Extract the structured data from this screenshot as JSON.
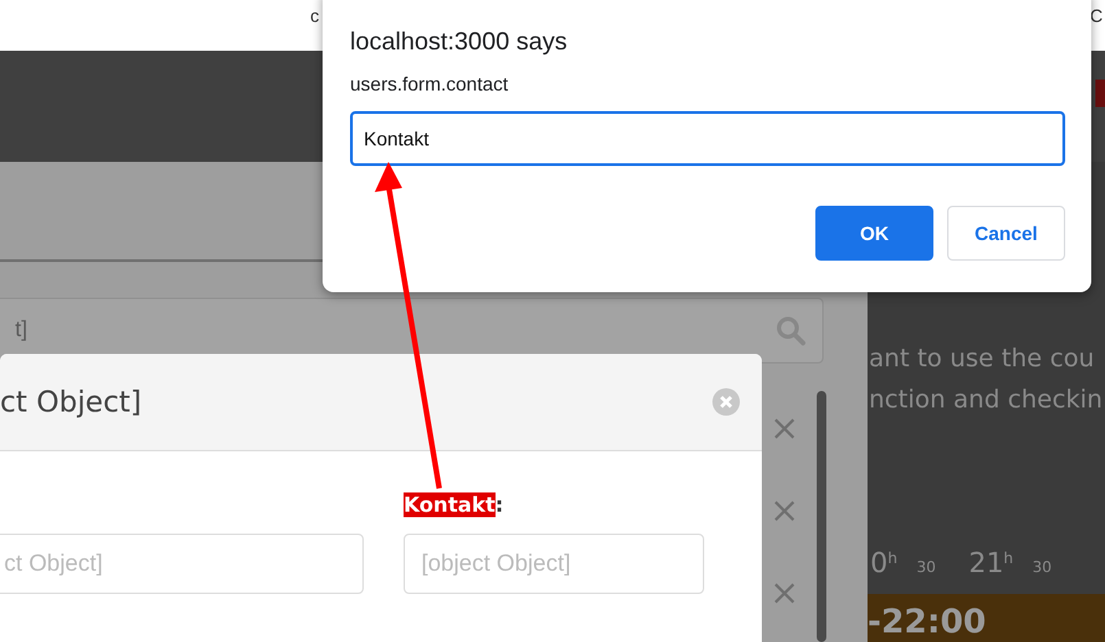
{
  "browser_bar": {
    "texts": [
      "c",
      "C"
    ]
  },
  "page": {
    "search_field": {
      "placeholder": "t]"
    },
    "notice_lines": [
      "ant to use the cou",
      "nction and checkin"
    ],
    "timeline": [
      {
        "hour": "0",
        "sup": "h",
        "half": "30"
      },
      {
        "hour": "21",
        "sup": "h",
        "half": "30"
      }
    ],
    "event": {
      "time": "-22:00"
    }
  },
  "modal": {
    "title": "ct Object]",
    "fields": [
      {
        "placeholder": "ct Object]"
      },
      {
        "label": "Kontakt",
        "label_suffix": ":",
        "highlighted": true,
        "placeholder": "[object Object]"
      }
    ]
  },
  "alert": {
    "title": "localhost:3000 says",
    "message": "users.form.contact",
    "value": "Kontakt",
    "buttons": [
      {
        "label": "OK",
        "kind": "primary"
      },
      {
        "label": "Cancel",
        "kind": "secondary"
      }
    ]
  }
}
